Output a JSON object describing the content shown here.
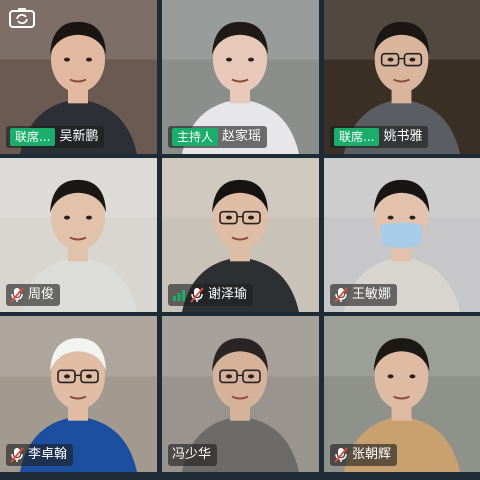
{
  "participants": [
    {
      "name": "吴新鹏",
      "role": "联席...",
      "mic": "none",
      "bg": "#6b5a52",
      "skin": "#e2b8a0",
      "hair": "#1a1512",
      "shirt": "#2c2f35"
    },
    {
      "name": "赵家瑶",
      "role": "主持人",
      "mic": "none",
      "bg": "#8a8f8c",
      "skin": "#e8c8b8",
      "hair": "#1f1a17",
      "shirt": "#e7e7ea"
    },
    {
      "name": "姚书雅",
      "role": "联席...",
      "mic": "none",
      "bg": "#3a3026",
      "skin": "#d9b59d",
      "hair": "#1c1715",
      "shirt": "#5a5d62"
    },
    {
      "name": "周俊",
      "role": "",
      "mic": "muted",
      "bg": "#d9d6d2",
      "skin": "#e2c2aa",
      "hair": "#1b1714",
      "shirt": "#dcdcda"
    },
    {
      "name": "谢泽瑜",
      "role": "",
      "mic": "active",
      "bg": "#c9c2b8",
      "skin": "#e0bea6",
      "hair": "#151312",
      "shirt": "#2d3033"
    },
    {
      "name": "王敏娜",
      "role": "",
      "mic": "muted",
      "bg": "#c7c6c8",
      "skin": "#e3c2ad",
      "hair": "#181514",
      "shirt": "#d8d4cf"
    },
    {
      "name": "李卓翰",
      "role": "",
      "mic": "muted",
      "bg": "#a39a8f",
      "skin": "#e0bda4",
      "hair": "#f3f3f2",
      "shirt": "#1d4fa0"
    },
    {
      "name": "冯少华",
      "role": "",
      "mic": "none",
      "bg": "#9a948e",
      "skin": "#d7b29b",
      "hair": "#2a2522",
      "shirt": "#6c6b68"
    },
    {
      "name": "张朝辉",
      "role": "",
      "mic": "muted",
      "bg": "#8e928a",
      "skin": "#dfbba3",
      "hair": "#1c1816",
      "shirt": "#c9a070"
    }
  ],
  "icons": {
    "camera_switch": "camera-switch-icon",
    "muted": "mic-off-icon",
    "active": "signal-bars-icon"
  },
  "colors": {
    "accent": "#1aad6b",
    "muted": "#e84b3c"
  }
}
